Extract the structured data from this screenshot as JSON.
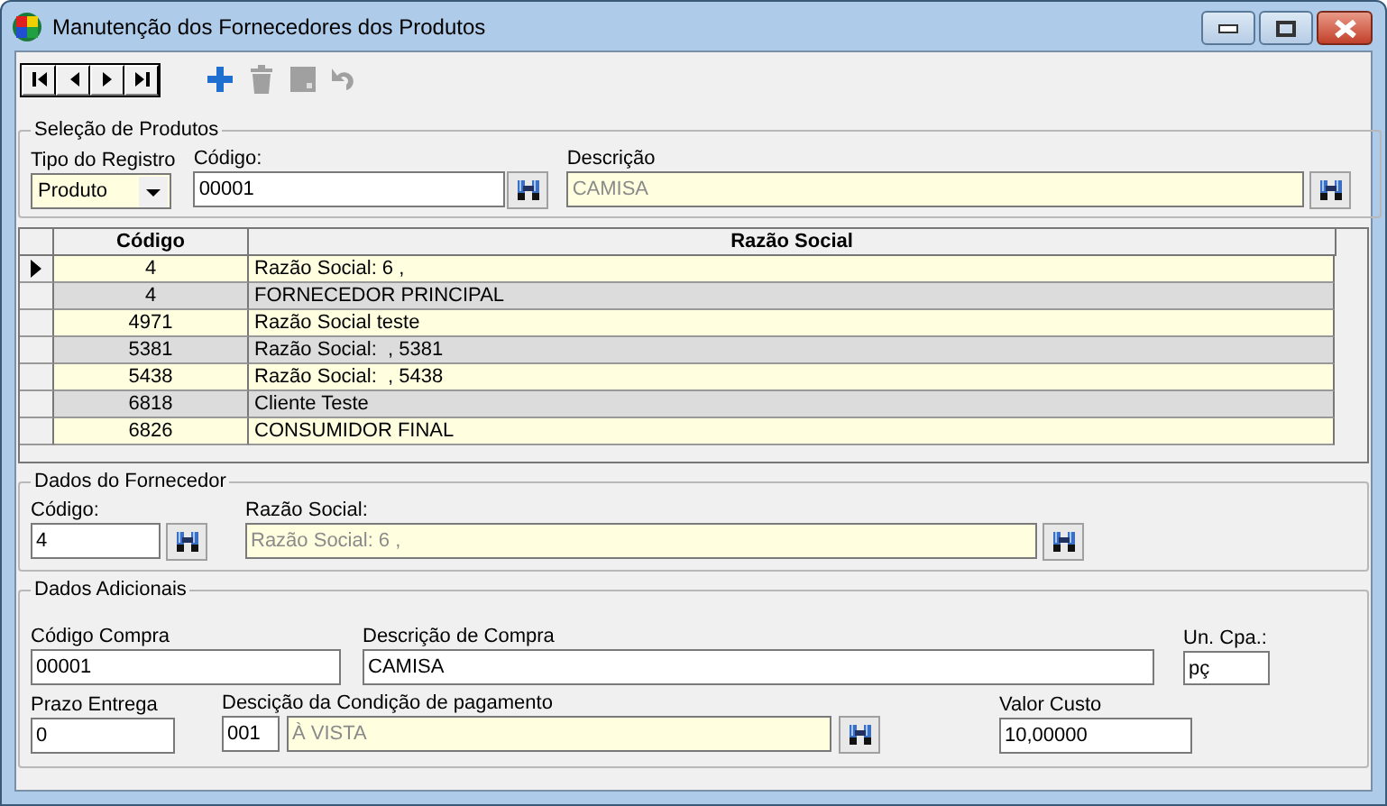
{
  "window": {
    "title": "Manutenção dos Fornecedores dos Produtos"
  },
  "toolbar": [
    {
      "kind": "add",
      "disabled": false
    },
    {
      "kind": "delete",
      "disabled": true
    },
    {
      "kind": "save",
      "disabled": true
    },
    {
      "kind": "undo",
      "disabled": true
    }
  ],
  "product_selection": {
    "title": "Seleção de Produtos",
    "record_type": {
      "label": "Tipo do Registro",
      "value": "Produto"
    },
    "code": {
      "label": "Código:",
      "value": "00001",
      "readonly": false
    },
    "description": {
      "label": "Descrição",
      "value": "CAMISA",
      "readonly": true
    }
  },
  "table": {
    "columns": [
      "Código",
      "Razão Social"
    ],
    "rows": [
      {
        "code": "4",
        "name": "Razão Social: 6 ,",
        "selected": true
      },
      {
        "code": "4",
        "name": "FORNECEDOR PRINCIPAL",
        "selected": false
      },
      {
        "code": "4971",
        "name": "Razão Social teste",
        "selected": false
      },
      {
        "code": "5381",
        "name": "Razão Social:  , 5381",
        "selected": false
      },
      {
        "code": "5438",
        "name": "Razão Social:  , 5438",
        "selected": false
      },
      {
        "code": "6818",
        "name": "Cliente Teste",
        "selected": false
      },
      {
        "code": "6826",
        "name": "CONSUMIDOR FINAL",
        "selected": false
      }
    ]
  },
  "supplier": {
    "title": "Dados do Fornecedor",
    "code": {
      "label": "Código:",
      "value": "4",
      "readonly": false
    },
    "name": {
      "label": "Razão Social:",
      "value": "Razão Social: 6 ,",
      "readonly": true
    }
  },
  "additional": {
    "title": "Dados Adicionais",
    "purchase_code": {
      "label": "Código Compra",
      "value": "00001",
      "readonly": false
    },
    "purchase_description": {
      "label": "Descrição de Compra",
      "value": "CAMISA",
      "readonly": false
    },
    "purchase_unit": {
      "label": "Un. Cpa.:",
      "value": "pç",
      "readonly": false
    },
    "delivery_time": {
      "label": "Prazo Entrega",
      "value": "0",
      "readonly": false
    },
    "payment_condition": {
      "label": "Descição da Condição de pagamento",
      "code": "001",
      "value": "À VISTA",
      "readonly": true
    },
    "cost_value": {
      "label": "Valor Custo",
      "value": "10,00000",
      "readonly": false
    }
  }
}
